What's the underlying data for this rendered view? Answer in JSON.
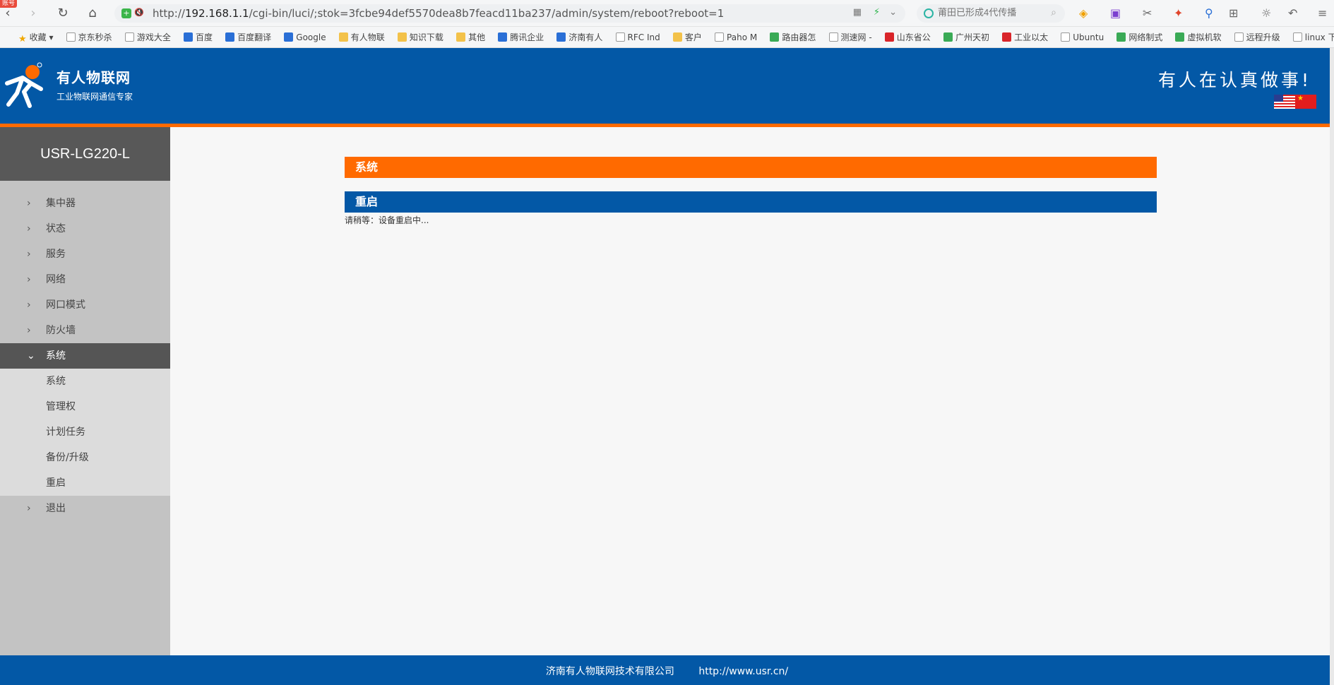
{
  "browser": {
    "badge": "账号",
    "url": {
      "scheme": "http://",
      "host": "192.168.1.1",
      "path": "/cgi-bin/luci/;stok=3fcbe94def5570dea8b7feacd11ba237/admin/system/reboot?reboot=1"
    },
    "search_placeholder": "莆田已形成4代传播",
    "bookmarks": [
      {
        "label": "收藏",
        "icon": "star-icon"
      },
      {
        "label": "京东秒杀",
        "icon": "page-icon"
      },
      {
        "label": "游戏大全",
        "icon": "page-icon"
      },
      {
        "label": "百度",
        "icon": "baidu-icon"
      },
      {
        "label": "百度翻译",
        "icon": "translate-icon"
      },
      {
        "label": "Google",
        "icon": "google-icon"
      },
      {
        "label": "有人物联",
        "icon": "folder-icon"
      },
      {
        "label": "知识下载",
        "icon": "folder-icon"
      },
      {
        "label": "其他",
        "icon": "folder-icon"
      },
      {
        "label": "腾讯企业",
        "icon": "tencent-icon"
      },
      {
        "label": "济南有人",
        "icon": "usr-icon"
      },
      {
        "label": "RFC Ind",
        "icon": "page-icon"
      },
      {
        "label": "客户",
        "icon": "folder-icon"
      },
      {
        "label": "Paho M",
        "icon": "eclipse-icon"
      },
      {
        "label": "路由器怎",
        "icon": "search-icon"
      },
      {
        "label": "测速网 -",
        "icon": "speed-icon"
      },
      {
        "label": "山东省公",
        "icon": "police-icon"
      },
      {
        "label": "广州天初",
        "icon": "leaf-icon"
      },
      {
        "label": "工业以太",
        "icon": "c-icon"
      },
      {
        "label": "Ubuntu",
        "icon": "page-icon"
      },
      {
        "label": "网络制式",
        "icon": "search-icon"
      },
      {
        "label": "虚拟机软",
        "icon": "grid-icon"
      },
      {
        "label": "远程升级",
        "icon": "page-icon"
      },
      {
        "label": "linux 下",
        "icon": "linux-icon"
      }
    ]
  },
  "header": {
    "brand": "有人物联网",
    "tagline": "工业物联网通信专家",
    "slogan": "有人在认真做事!"
  },
  "sidebar": {
    "device_name": "USR-LG220-L",
    "menu": [
      {
        "label": "集中器"
      },
      {
        "label": "状态"
      },
      {
        "label": "服务"
      },
      {
        "label": "网络"
      },
      {
        "label": "网口模式"
      },
      {
        "label": "防火墙"
      }
    ],
    "active": {
      "label": "系统"
    },
    "submenu": [
      {
        "label": "系统"
      },
      {
        "label": "管理权"
      },
      {
        "label": "计划任务"
      },
      {
        "label": "备份/升级"
      },
      {
        "label": "重启"
      }
    ],
    "logout": {
      "label": "退出"
    }
  },
  "main": {
    "section_title": "系统",
    "panel_title": "重启",
    "message": "请稍等：设备重启中..."
  },
  "footer": {
    "company": "济南有人物联网技术有限公司",
    "website": "http://www.usr.cn/"
  },
  "colors": {
    "primary_blue": "#0358a6",
    "accent_orange": "#ff6a00",
    "sidebar_gray": "#c3c3c3",
    "device_header": "#585858"
  }
}
